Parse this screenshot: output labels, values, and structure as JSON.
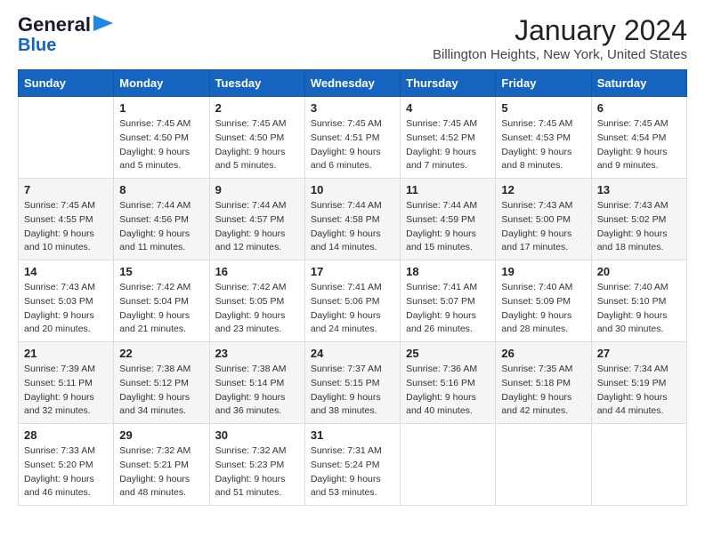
{
  "logo": {
    "line1": "General",
    "line2": "Blue"
  },
  "title": "January 2024",
  "subtitle": "Billington Heights, New York, United States",
  "weekdays": [
    "Sunday",
    "Monday",
    "Tuesday",
    "Wednesday",
    "Thursday",
    "Friday",
    "Saturday"
  ],
  "weeks": [
    [
      {
        "day": "",
        "sunrise": "",
        "sunset": "",
        "daylight": ""
      },
      {
        "day": "1",
        "sunrise": "Sunrise: 7:45 AM",
        "sunset": "Sunset: 4:50 PM",
        "daylight": "Daylight: 9 hours and 5 minutes."
      },
      {
        "day": "2",
        "sunrise": "Sunrise: 7:45 AM",
        "sunset": "Sunset: 4:50 PM",
        "daylight": "Daylight: 9 hours and 5 minutes."
      },
      {
        "day": "3",
        "sunrise": "Sunrise: 7:45 AM",
        "sunset": "Sunset: 4:51 PM",
        "daylight": "Daylight: 9 hours and 6 minutes."
      },
      {
        "day": "4",
        "sunrise": "Sunrise: 7:45 AM",
        "sunset": "Sunset: 4:52 PM",
        "daylight": "Daylight: 9 hours and 7 minutes."
      },
      {
        "day": "5",
        "sunrise": "Sunrise: 7:45 AM",
        "sunset": "Sunset: 4:53 PM",
        "daylight": "Daylight: 9 hours and 8 minutes."
      },
      {
        "day": "6",
        "sunrise": "Sunrise: 7:45 AM",
        "sunset": "Sunset: 4:54 PM",
        "daylight": "Daylight: 9 hours and 9 minutes."
      }
    ],
    [
      {
        "day": "7",
        "sunrise": "Sunrise: 7:45 AM",
        "sunset": "Sunset: 4:55 PM",
        "daylight": "Daylight: 9 hours and 10 minutes."
      },
      {
        "day": "8",
        "sunrise": "Sunrise: 7:44 AM",
        "sunset": "Sunset: 4:56 PM",
        "daylight": "Daylight: 9 hours and 11 minutes."
      },
      {
        "day": "9",
        "sunrise": "Sunrise: 7:44 AM",
        "sunset": "Sunset: 4:57 PM",
        "daylight": "Daylight: 9 hours and 12 minutes."
      },
      {
        "day": "10",
        "sunrise": "Sunrise: 7:44 AM",
        "sunset": "Sunset: 4:58 PM",
        "daylight": "Daylight: 9 hours and 14 minutes."
      },
      {
        "day": "11",
        "sunrise": "Sunrise: 7:44 AM",
        "sunset": "Sunset: 4:59 PM",
        "daylight": "Daylight: 9 hours and 15 minutes."
      },
      {
        "day": "12",
        "sunrise": "Sunrise: 7:43 AM",
        "sunset": "Sunset: 5:00 PM",
        "daylight": "Daylight: 9 hours and 17 minutes."
      },
      {
        "day": "13",
        "sunrise": "Sunrise: 7:43 AM",
        "sunset": "Sunset: 5:02 PM",
        "daylight": "Daylight: 9 hours and 18 minutes."
      }
    ],
    [
      {
        "day": "14",
        "sunrise": "Sunrise: 7:43 AM",
        "sunset": "Sunset: 5:03 PM",
        "daylight": "Daylight: 9 hours and 20 minutes."
      },
      {
        "day": "15",
        "sunrise": "Sunrise: 7:42 AM",
        "sunset": "Sunset: 5:04 PM",
        "daylight": "Daylight: 9 hours and 21 minutes."
      },
      {
        "day": "16",
        "sunrise": "Sunrise: 7:42 AM",
        "sunset": "Sunset: 5:05 PM",
        "daylight": "Daylight: 9 hours and 23 minutes."
      },
      {
        "day": "17",
        "sunrise": "Sunrise: 7:41 AM",
        "sunset": "Sunset: 5:06 PM",
        "daylight": "Daylight: 9 hours and 24 minutes."
      },
      {
        "day": "18",
        "sunrise": "Sunrise: 7:41 AM",
        "sunset": "Sunset: 5:07 PM",
        "daylight": "Daylight: 9 hours and 26 minutes."
      },
      {
        "day": "19",
        "sunrise": "Sunrise: 7:40 AM",
        "sunset": "Sunset: 5:09 PM",
        "daylight": "Daylight: 9 hours and 28 minutes."
      },
      {
        "day": "20",
        "sunrise": "Sunrise: 7:40 AM",
        "sunset": "Sunset: 5:10 PM",
        "daylight": "Daylight: 9 hours and 30 minutes."
      }
    ],
    [
      {
        "day": "21",
        "sunrise": "Sunrise: 7:39 AM",
        "sunset": "Sunset: 5:11 PM",
        "daylight": "Daylight: 9 hours and 32 minutes."
      },
      {
        "day": "22",
        "sunrise": "Sunrise: 7:38 AM",
        "sunset": "Sunset: 5:12 PM",
        "daylight": "Daylight: 9 hours and 34 minutes."
      },
      {
        "day": "23",
        "sunrise": "Sunrise: 7:38 AM",
        "sunset": "Sunset: 5:14 PM",
        "daylight": "Daylight: 9 hours and 36 minutes."
      },
      {
        "day": "24",
        "sunrise": "Sunrise: 7:37 AM",
        "sunset": "Sunset: 5:15 PM",
        "daylight": "Daylight: 9 hours and 38 minutes."
      },
      {
        "day": "25",
        "sunrise": "Sunrise: 7:36 AM",
        "sunset": "Sunset: 5:16 PM",
        "daylight": "Daylight: 9 hours and 40 minutes."
      },
      {
        "day": "26",
        "sunrise": "Sunrise: 7:35 AM",
        "sunset": "Sunset: 5:18 PM",
        "daylight": "Daylight: 9 hours and 42 minutes."
      },
      {
        "day": "27",
        "sunrise": "Sunrise: 7:34 AM",
        "sunset": "Sunset: 5:19 PM",
        "daylight": "Daylight: 9 hours and 44 minutes."
      }
    ],
    [
      {
        "day": "28",
        "sunrise": "Sunrise: 7:33 AM",
        "sunset": "Sunset: 5:20 PM",
        "daylight": "Daylight: 9 hours and 46 minutes."
      },
      {
        "day": "29",
        "sunrise": "Sunrise: 7:32 AM",
        "sunset": "Sunset: 5:21 PM",
        "daylight": "Daylight: 9 hours and 48 minutes."
      },
      {
        "day": "30",
        "sunrise": "Sunrise: 7:32 AM",
        "sunset": "Sunset: 5:23 PM",
        "daylight": "Daylight: 9 hours and 51 minutes."
      },
      {
        "day": "31",
        "sunrise": "Sunrise: 7:31 AM",
        "sunset": "Sunset: 5:24 PM",
        "daylight": "Daylight: 9 hours and 53 minutes."
      },
      {
        "day": "",
        "sunrise": "",
        "sunset": "",
        "daylight": ""
      },
      {
        "day": "",
        "sunrise": "",
        "sunset": "",
        "daylight": ""
      },
      {
        "day": "",
        "sunrise": "",
        "sunset": "",
        "daylight": ""
      }
    ]
  ]
}
